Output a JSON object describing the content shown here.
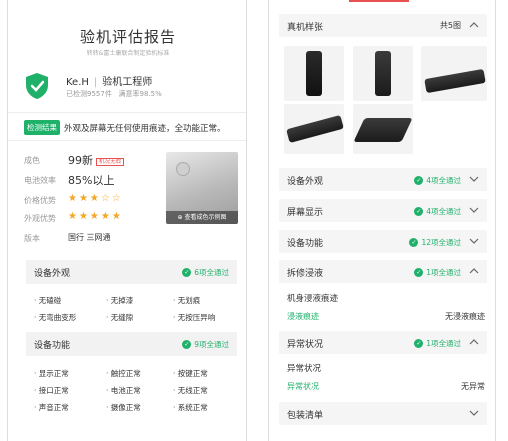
{
  "report": {
    "title": "验机评估报告",
    "subtitle": "转转&富士康联合制定验机标准"
  },
  "inspector": {
    "name": "Ke.H",
    "role": "验机工程师",
    "checked": "已检测9557件",
    "satisfaction": "满意率98.5%"
  },
  "result": {
    "tag": "检测结果",
    "text": "外观及屏幕无任何使用痕迹，全功能正常。"
  },
  "attributes": {
    "condition_label": "成色",
    "condition_value": "99新",
    "condition_tag": "机况无瑕",
    "battery_label": "电池效率",
    "battery_value": "85%以上",
    "price_label": "价格优势",
    "price_stars": 3,
    "look_label": "外观优势",
    "look_stars": 5,
    "version_label": "版本",
    "version_value": "国行 三网通"
  },
  "photo_caption": "查看成色示例图",
  "left_sections": {
    "appearance": {
      "label": "设备外观",
      "pass": "6项全通过",
      "items": [
        "无磕碰",
        "无掉漆",
        "无划痕",
        "无弯曲变形",
        "无缝隙",
        "无按压异响"
      ]
    },
    "function": {
      "label": "设备功能",
      "pass": "9项全通过",
      "items": [
        "显示正常",
        "触控正常",
        "按键正常",
        "接口正常",
        "电池正常",
        "无线正常",
        "声音正常",
        "摄像正常",
        "系统正常"
      ]
    }
  },
  "right": {
    "samples_label": "真机样张",
    "samples_count": "共5图",
    "rows": [
      {
        "label": "设备外观",
        "pass": "4项全通过"
      },
      {
        "label": "屏幕显示",
        "pass": "4项全通过"
      },
      {
        "label": "设备功能",
        "pass": "12项全通过"
      },
      {
        "label": "拆修浸液",
        "pass": "1项全通过"
      },
      {
        "label": "异常状况",
        "pass": "1项全通过"
      },
      {
        "label": "包装清单"
      }
    ],
    "liquid_title": "机身浸液痕迹",
    "liquid_key": "浸液痕迹",
    "liquid_value": "无浸液痕迹",
    "abnormal_title": "异常状况",
    "abnormal_key": "异常状况",
    "abnormal_value": "无异常"
  },
  "colors": {
    "green": "#1fb06a",
    "red": "#e95050",
    "star": "#f5a623"
  },
  "icons": [
    "shield-check-icon",
    "check-circle-icon",
    "chevron-up-icon",
    "chevron-down-icon",
    "zoom-icon"
  ]
}
